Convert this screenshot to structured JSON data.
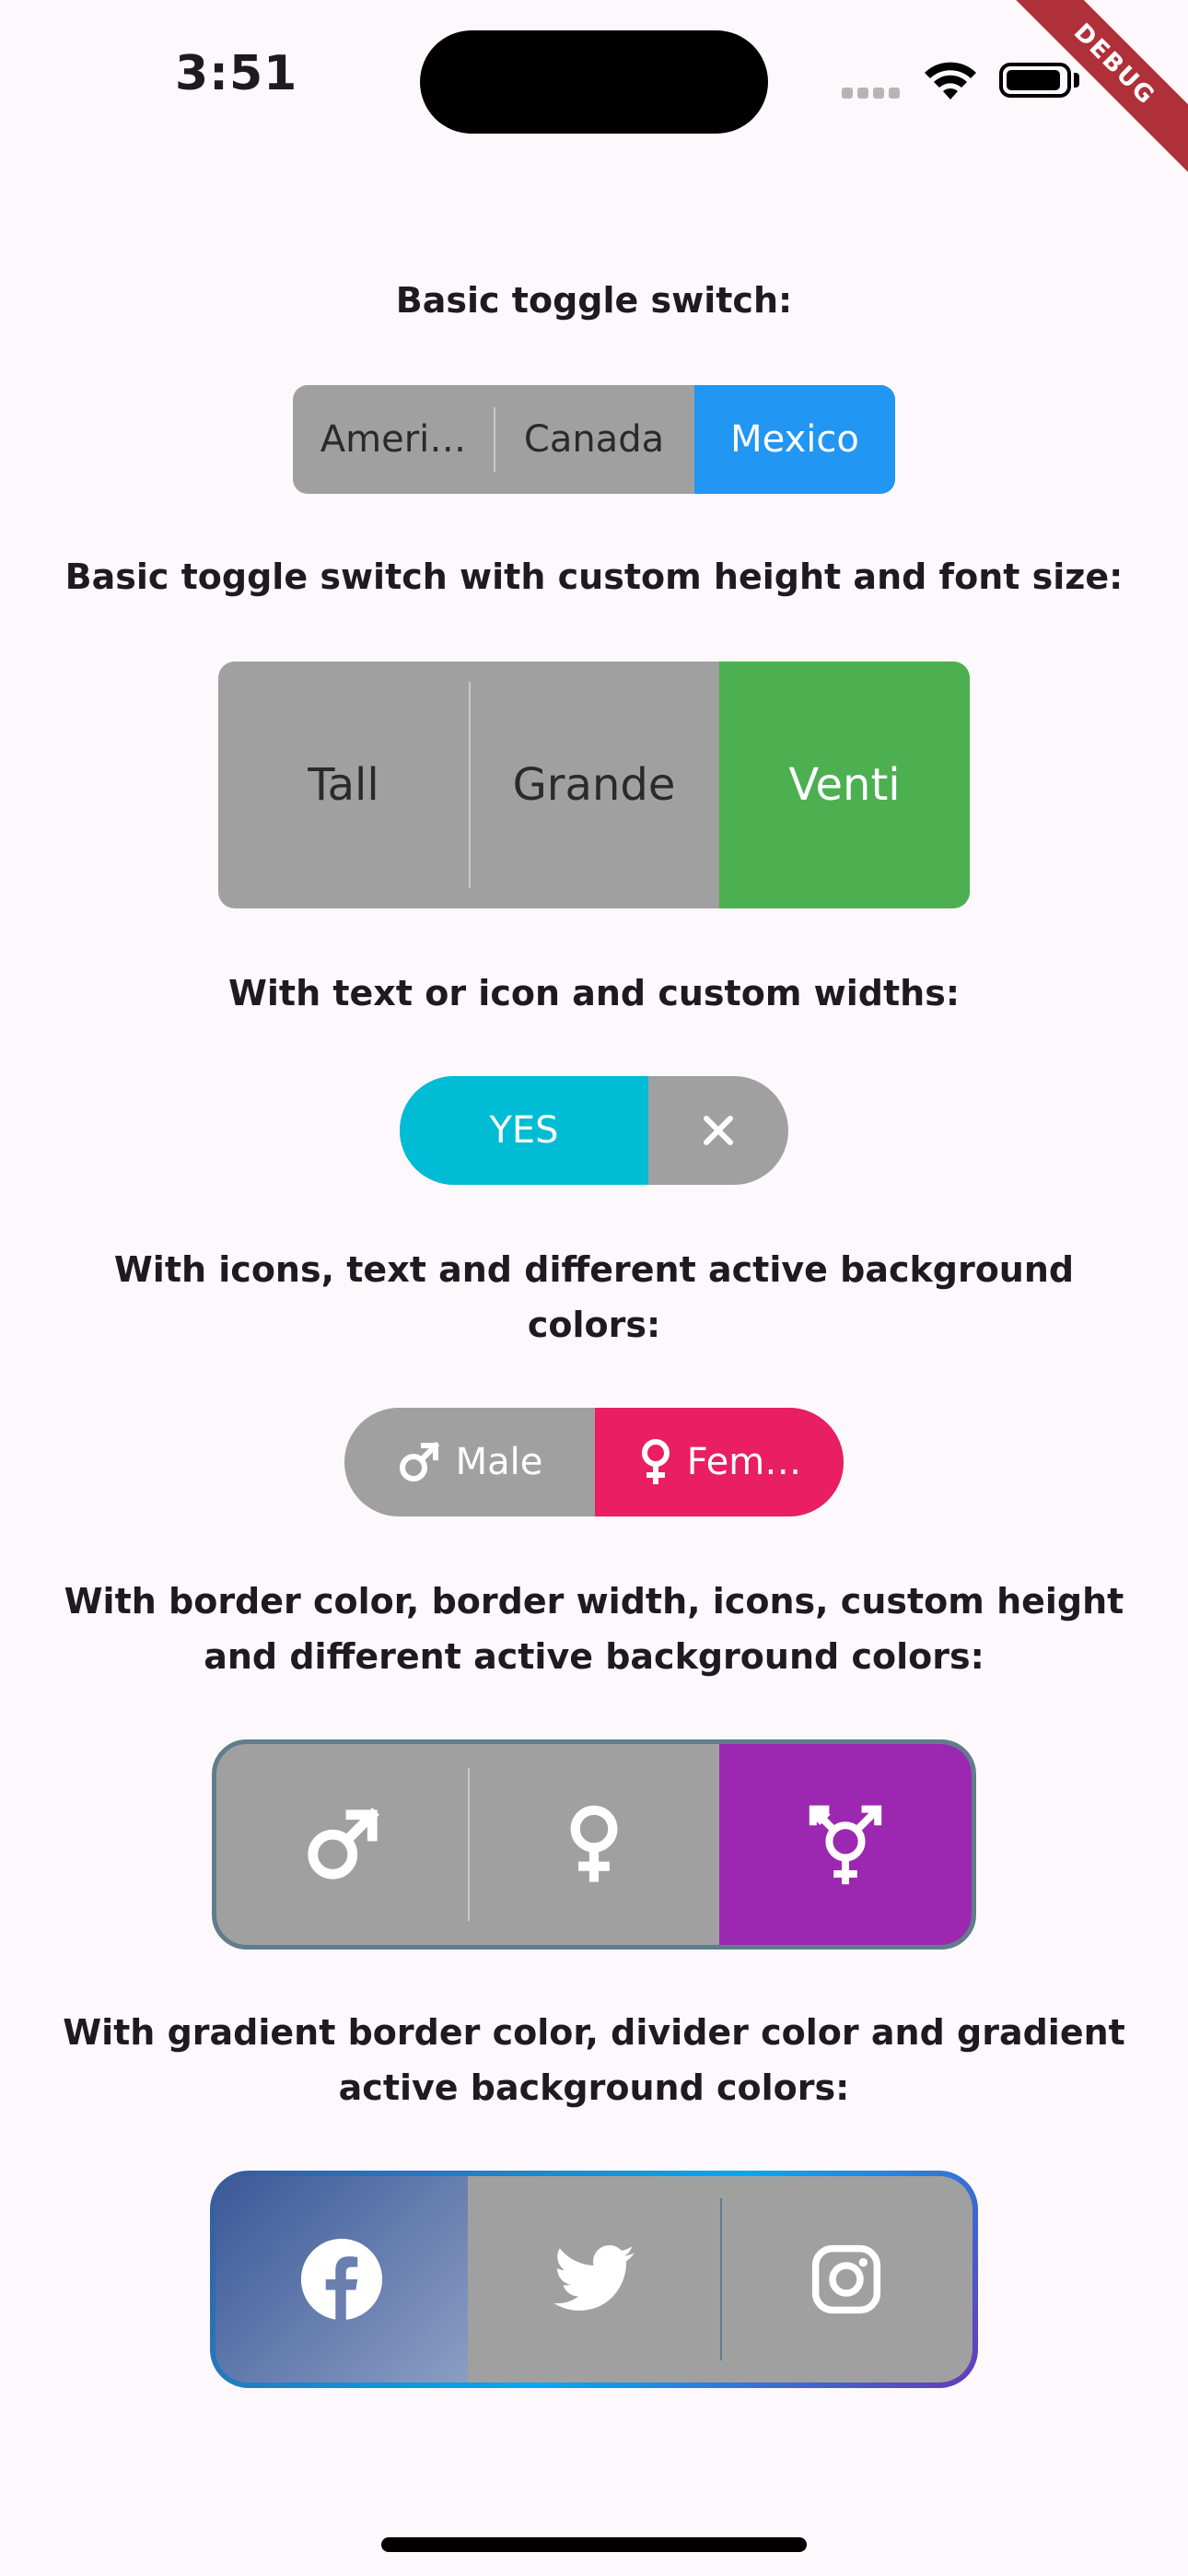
{
  "status_bar": {
    "time": "3:51",
    "debug_label": "DEBUG"
  },
  "sections": [
    {
      "heading": "Basic toggle switch:",
      "labels": [
        "Ameri…",
        "Canada",
        "Mexico"
      ],
      "active_index": 2,
      "active_color": "#2196f3"
    },
    {
      "heading": "Basic toggle switch with custom height and font size:",
      "labels": [
        "Tall",
        "Grande",
        "Venti"
      ],
      "active_index": 2,
      "active_color": "#4caf50"
    },
    {
      "heading": "With text or icon and custom widths:",
      "labels": [
        "YES",
        ""
      ],
      "icons": [
        "",
        "close-icon"
      ],
      "active_index": 0,
      "active_color": "#00bcd4"
    },
    {
      "heading_line1": "With icons, text and different active background",
      "heading_line2": "colors:",
      "labels": [
        "Male",
        "Fem…"
      ],
      "icons": [
        "male-icon",
        "female-icon"
      ],
      "active_index": 1,
      "active_color": "#e91e63"
    },
    {
      "heading_line1": "With border color, border width, icons, custom height",
      "heading_line2": "and different active background colors:",
      "icons": [
        "male-icon",
        "female-icon",
        "transgender-icon"
      ],
      "active_index": 2,
      "active_color": "#9c27b0",
      "border_color": "#607d8b"
    },
    {
      "heading_line1": "With gradient border color, divider color and gradient",
      "heading_line2": "active background colors:",
      "icons": [
        "facebook-icon",
        "twitter-icon",
        "instagram-icon"
      ],
      "active_index": 0,
      "active_gradient": [
        "#3b5998",
        "#8b9dc3"
      ],
      "border_gradient": [
        "#3b5998",
        "#03a9f4",
        "#673ab7"
      ],
      "divider_color": "#607d8b"
    }
  ]
}
